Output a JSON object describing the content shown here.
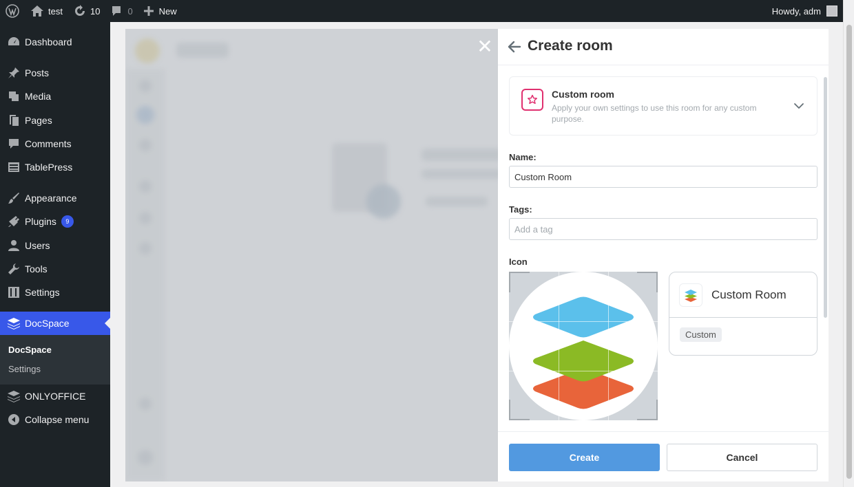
{
  "adminbar": {
    "site_name": "test",
    "updates_count": "10",
    "comments_count": "0",
    "new_label": "New",
    "greeting": "Howdy, adm"
  },
  "sidebar": {
    "items": [
      {
        "label": "Dashboard",
        "icon": "dashboard-icon"
      },
      {
        "label": "Posts",
        "icon": "pin-icon"
      },
      {
        "label": "Media",
        "icon": "media-icon"
      },
      {
        "label": "Pages",
        "icon": "pages-icon"
      },
      {
        "label": "Comments",
        "icon": "comment-icon"
      },
      {
        "label": "TablePress",
        "icon": "table-icon"
      },
      {
        "label": "Appearance",
        "icon": "brush-icon"
      },
      {
        "label": "Plugins",
        "icon": "plug-icon",
        "badge": "9"
      },
      {
        "label": "Users",
        "icon": "user-icon"
      },
      {
        "label": "Tools",
        "icon": "wrench-icon"
      },
      {
        "label": "Settings",
        "icon": "sliders-icon"
      },
      {
        "label": "DocSpace",
        "icon": "layers-icon",
        "active": true
      },
      {
        "label": "ONLYOFFICE",
        "icon": "layers-icon"
      },
      {
        "label": "Collapse menu",
        "icon": "collapse-icon"
      }
    ],
    "submenu": [
      {
        "label": "DocSpace",
        "current": true
      },
      {
        "label": "Settings"
      }
    ]
  },
  "panel": {
    "title": "Create room",
    "room_type": {
      "title": "Custom room",
      "description": "Apply your own settings to use this room for any custom purpose."
    },
    "name_label": "Name:",
    "name_value": "Custom Room",
    "tags_label": "Tags:",
    "tags_placeholder": "Add a tag",
    "icon_label": "Icon",
    "preview": {
      "name": "Custom Room",
      "tag": "Custom"
    },
    "create_label": "Create",
    "cancel_label": "Cancel"
  },
  "colors": {
    "accent": "#3858e9",
    "primary_button": "#5299e0",
    "room_icon_border": "#e0306f",
    "logo_blue": "#5bc0eb",
    "logo_green": "#8bba25",
    "logo_orange": "#e8643a"
  }
}
